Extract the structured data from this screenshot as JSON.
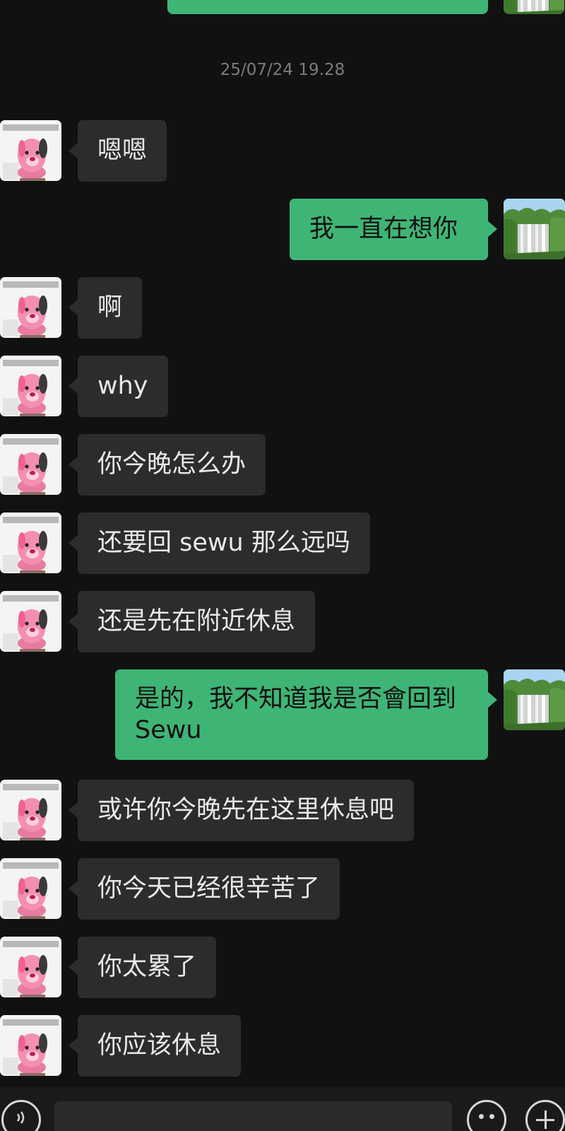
{
  "timestamp": "25/07/24 19.28",
  "messages": [
    {
      "side": "in",
      "text": "嗯嗯"
    },
    {
      "side": "out",
      "text": "我一直在想你"
    },
    {
      "side": "in",
      "text": "啊"
    },
    {
      "side": "in",
      "text": "why"
    },
    {
      "side": "in",
      "text": "你今晚怎么办"
    },
    {
      "side": "in",
      "text": "还要回 sewu 那么远吗"
    },
    {
      "side": "in",
      "text": "还是先在附近休息"
    },
    {
      "side": "out",
      "text": "是的，我不知道我是否會回到\nSewu"
    },
    {
      "side": "in",
      "text": "或许你今晚先在这里休息吧"
    },
    {
      "side": "in",
      "text": "你今天已经很辛苦了"
    },
    {
      "side": "in",
      "text": "你太累了"
    },
    {
      "side": "in",
      "text": "你应该休息"
    }
  ],
  "input": {
    "value": "",
    "placeholder": ""
  },
  "icons": {
    "contact_avatar": "pink-character-avatar-icon",
    "own_avatar": "waterfall-landscape-avatar-icon",
    "voice": "voice-wave-icon",
    "emoji": "emoji-smiley-icon",
    "more": "plus-icon"
  },
  "colors": {
    "background": "#111111",
    "incoming_bubble": "#2c2c2c",
    "outgoing_bubble": "#3eb575",
    "timestamp": "#7c7c7c"
  }
}
